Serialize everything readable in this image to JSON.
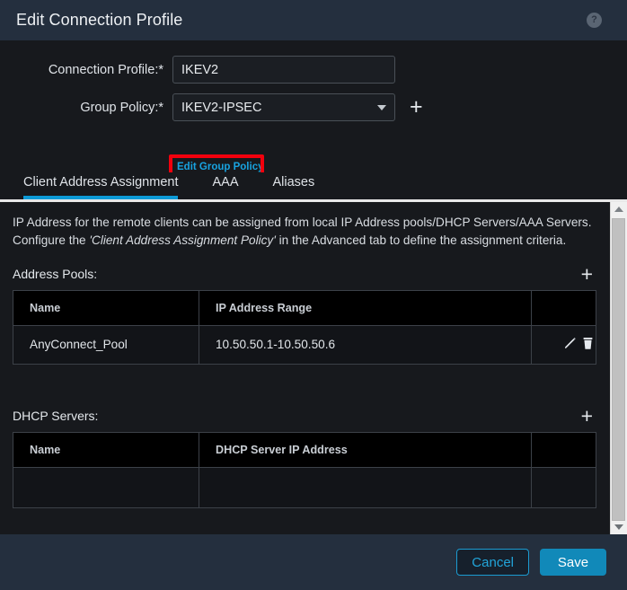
{
  "window": {
    "title": "Edit Connection Profile",
    "help_icon": "help-circle-icon",
    "help_glyph": "?"
  },
  "form": {
    "connection_profile": {
      "label": "Connection Profile:*",
      "value": "IKEV2",
      "placeholder": ""
    },
    "group_policy": {
      "label": "Group Policy:*",
      "value": "IKEV2-IPSEC",
      "add_label": "+",
      "edit_link": "Edit Group Policy",
      "highlight_color": "#f2000d"
    }
  },
  "tabs": [
    {
      "label": "Client Address Assignment",
      "active": true
    },
    {
      "label": "AAA",
      "active": false
    },
    {
      "label": "Aliases",
      "active": false
    }
  ],
  "content": {
    "description_part1": "IP Address for the remote clients can be assigned from local IP Address pools/DHCP Servers/AAA Servers. Configure the ",
    "description_emphasis": "'Client Address Assignment Policy'",
    "description_part2": " in the Advanced tab to define the assignment criteria.",
    "address_pools": {
      "title": "Address Pools:",
      "add_label": "+",
      "columns": [
        "Name",
        "IP Address Range",
        ""
      ],
      "rows": [
        {
          "name": "AnyConnect_Pool",
          "range": "10.50.50.1-10.50.50.6",
          "edit_icon": "pencil-icon",
          "delete_icon": "trash-icon"
        }
      ]
    },
    "dhcp_servers": {
      "title": "DHCP Servers:",
      "add_label": "+",
      "columns": [
        "Name",
        "DHCP Server IP Address",
        ""
      ],
      "rows": []
    }
  },
  "footer": {
    "cancel_label": "Cancel",
    "save_label": "Save"
  },
  "colors": {
    "accent": "#0d9ad6",
    "link": "#18a3e0",
    "save_button": "#1189b9",
    "highlight": "#f2000d",
    "titlebar": "#242f3e",
    "panel": "#17191d"
  }
}
